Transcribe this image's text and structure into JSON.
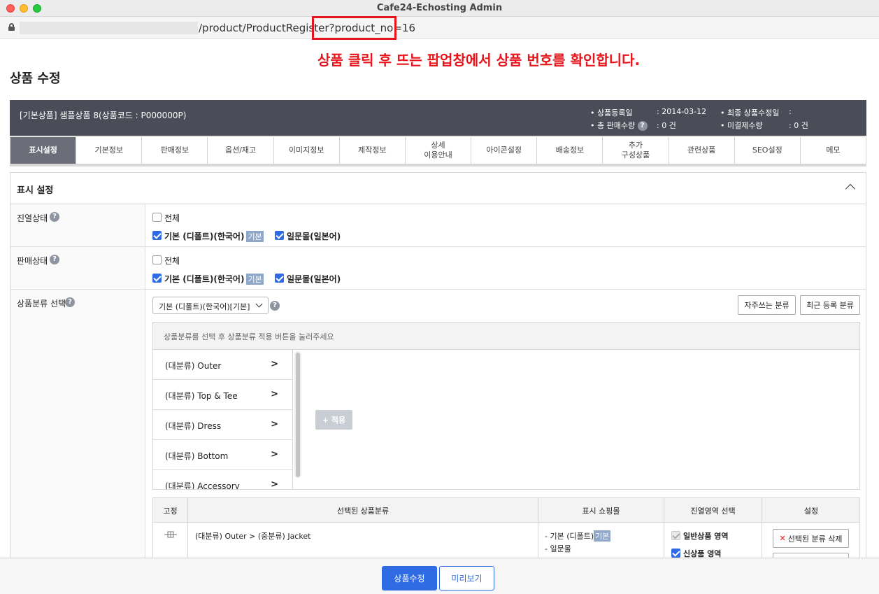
{
  "window": {
    "title": "Cafe24-Echosting Admin"
  },
  "browser": {
    "url_visible": "/product/ProductRegister?product_no=16"
  },
  "annotation": {
    "text": "상품 클릭 후 뜨는 팝업창에서 상품 번호를 확인합니다.",
    "color": "#e8141b"
  },
  "page": {
    "title": "상품 수정"
  },
  "product_bar": {
    "name": "[기본상품] 샘플상품 8(상품코드 : P000000P)",
    "reg_date_label": "• 상품등록일",
    "reg_date_value": ": 2014-03-12",
    "last_modified_label": "• 최종 상품수정일",
    "last_modified_value": ":",
    "total_sales_label": "• 총 판매수량",
    "total_sales_value": ": 0 건",
    "unpaid_label": "• 미결제수량",
    "unpaid_value": ": 0 건"
  },
  "tabs": [
    {
      "label": "표시설정",
      "active": true
    },
    {
      "label": "기본정보"
    },
    {
      "label": "판매정보"
    },
    {
      "label": "옵션/재고"
    },
    {
      "label": "이미지정보"
    },
    {
      "label": "제작정보"
    },
    {
      "label": "상세\n이용안내"
    },
    {
      "label": "아이콘설정"
    },
    {
      "label": "배송정보"
    },
    {
      "label": "추가\n구성상품"
    },
    {
      "label": "관련상품"
    },
    {
      "label": "SEO설정"
    },
    {
      "label": "메모"
    }
  ],
  "section": {
    "title": "표시 설정"
  },
  "display_status": {
    "label": "진열상태",
    "all_label": "전체",
    "default_label": "기본 (디폴트)(한국어)",
    "default_tag": "기본",
    "japan_label": "일문몰(일본어)"
  },
  "sale_status": {
    "label": "판매상태",
    "all_label": "전체",
    "default_label": "기본 (디폴트)(한국어)",
    "default_tag": "기본",
    "japan_label": "일문몰(일본어)"
  },
  "category": {
    "label": "상품분류 선택",
    "select_value": "기본 (디폴트)(한국어)[기본]",
    "btn_frequent": "자주쓰는 분류",
    "btn_recent": "최근 등록 분류",
    "hint": "상품분류를 선택 후 상품분류 적용 버튼을 눌러주세요",
    "items": [
      {
        "label": "(대분류) Outer",
        "arrow": ">"
      },
      {
        "label": "(대분류) Top & Tee",
        "arrow": ">"
      },
      {
        "label": "(대분류) Dress",
        "arrow": ">"
      },
      {
        "label": "(대분류) Bottom",
        "arrow": ">"
      },
      {
        "label": "(대분류) Accessory",
        "arrow": ">"
      }
    ],
    "apply_label": "+ 적용"
  },
  "selected_table": {
    "headers": [
      "고정",
      "선택된 상품분류",
      "표시 쇼핑몰",
      "진열영역 선택",
      "설정"
    ],
    "rows": [
      {
        "path": "(대분류) Outer > (중분류) Jacket",
        "mall_1": "- 기본 (디폴트)",
        "mall_1_tag": "기본",
        "mall_2": "- 일문몰",
        "area_1": "일반상품 영역",
        "area_2": "신상품 영역",
        "delete_label": "선택된 분류 삭제"
      }
    ]
  },
  "footer": {
    "save_label": "상품수정",
    "preview_label": "미리보기"
  }
}
